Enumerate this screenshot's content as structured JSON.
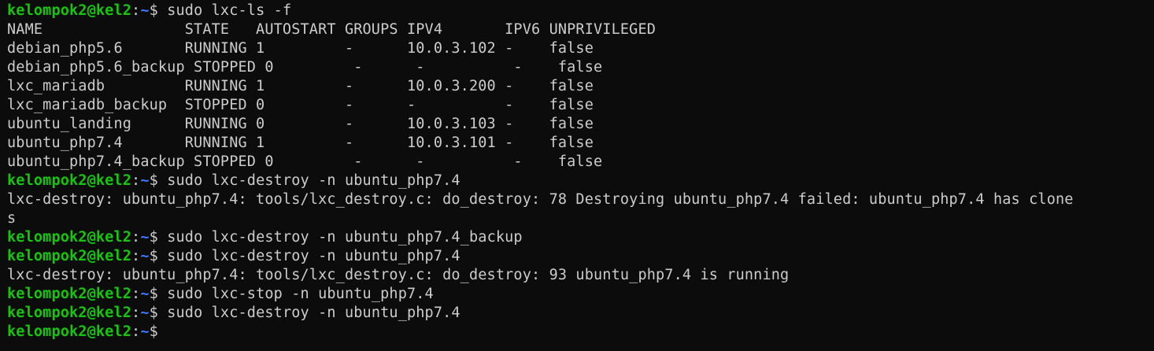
{
  "prompt": {
    "user_host": "kelompok2@kel2",
    "colon": ":",
    "path": "~",
    "symbol": "$ "
  },
  "lines": [
    {
      "type": "prompt",
      "command": "sudo lxc-ls -f"
    },
    {
      "type": "output",
      "text": "NAME                STATE   AUTOSTART GROUPS IPV4       IPV6 UNPRIVILEGED"
    },
    {
      "type": "output",
      "text": "debian_php5.6       RUNNING 1         -      10.0.3.102 -    false"
    },
    {
      "type": "output",
      "text": "debian_php5.6_backup STOPPED 0         -      -          -    false"
    },
    {
      "type": "output",
      "text": "lxc_mariadb         RUNNING 1         -      10.0.3.200 -    false"
    },
    {
      "type": "output",
      "text": "lxc_mariadb_backup  STOPPED 0         -      -          -    false"
    },
    {
      "type": "output",
      "text": "ubuntu_landing      RUNNING 0         -      10.0.3.103 -    false"
    },
    {
      "type": "output",
      "text": "ubuntu_php7.4       RUNNING 1         -      10.0.3.101 -    false"
    },
    {
      "type": "output",
      "text": "ubuntu_php7.4_backup STOPPED 0         -      -          -    false"
    },
    {
      "type": "prompt",
      "command": "sudo lxc-destroy -n ubuntu_php7.4"
    },
    {
      "type": "output",
      "text": "lxc-destroy: ubuntu_php7.4: tools/lxc_destroy.c: do_destroy: 78 Destroying ubuntu_php7.4 failed: ubuntu_php7.4 has clone"
    },
    {
      "type": "output",
      "text": "s"
    },
    {
      "type": "prompt",
      "command": "sudo lxc-destroy -n ubuntu_php7.4_backup"
    },
    {
      "type": "prompt",
      "command": "sudo lxc-destroy -n ubuntu_php7.4"
    },
    {
      "type": "output",
      "text": "lxc-destroy: ubuntu_php7.4: tools/lxc_destroy.c: do_destroy: 93 ubuntu_php7.4 is running"
    },
    {
      "type": "prompt",
      "command": "sudo lxc-stop -n ubuntu_php7.4"
    },
    {
      "type": "prompt",
      "command": "sudo lxc-destroy -n ubuntu_php7.4"
    },
    {
      "type": "prompt",
      "command": ""
    }
  ],
  "colors": {
    "background": "#0c0c0c",
    "foreground": "#cccccc",
    "user_host": "#16c60c",
    "path": "#3b78ff"
  }
}
